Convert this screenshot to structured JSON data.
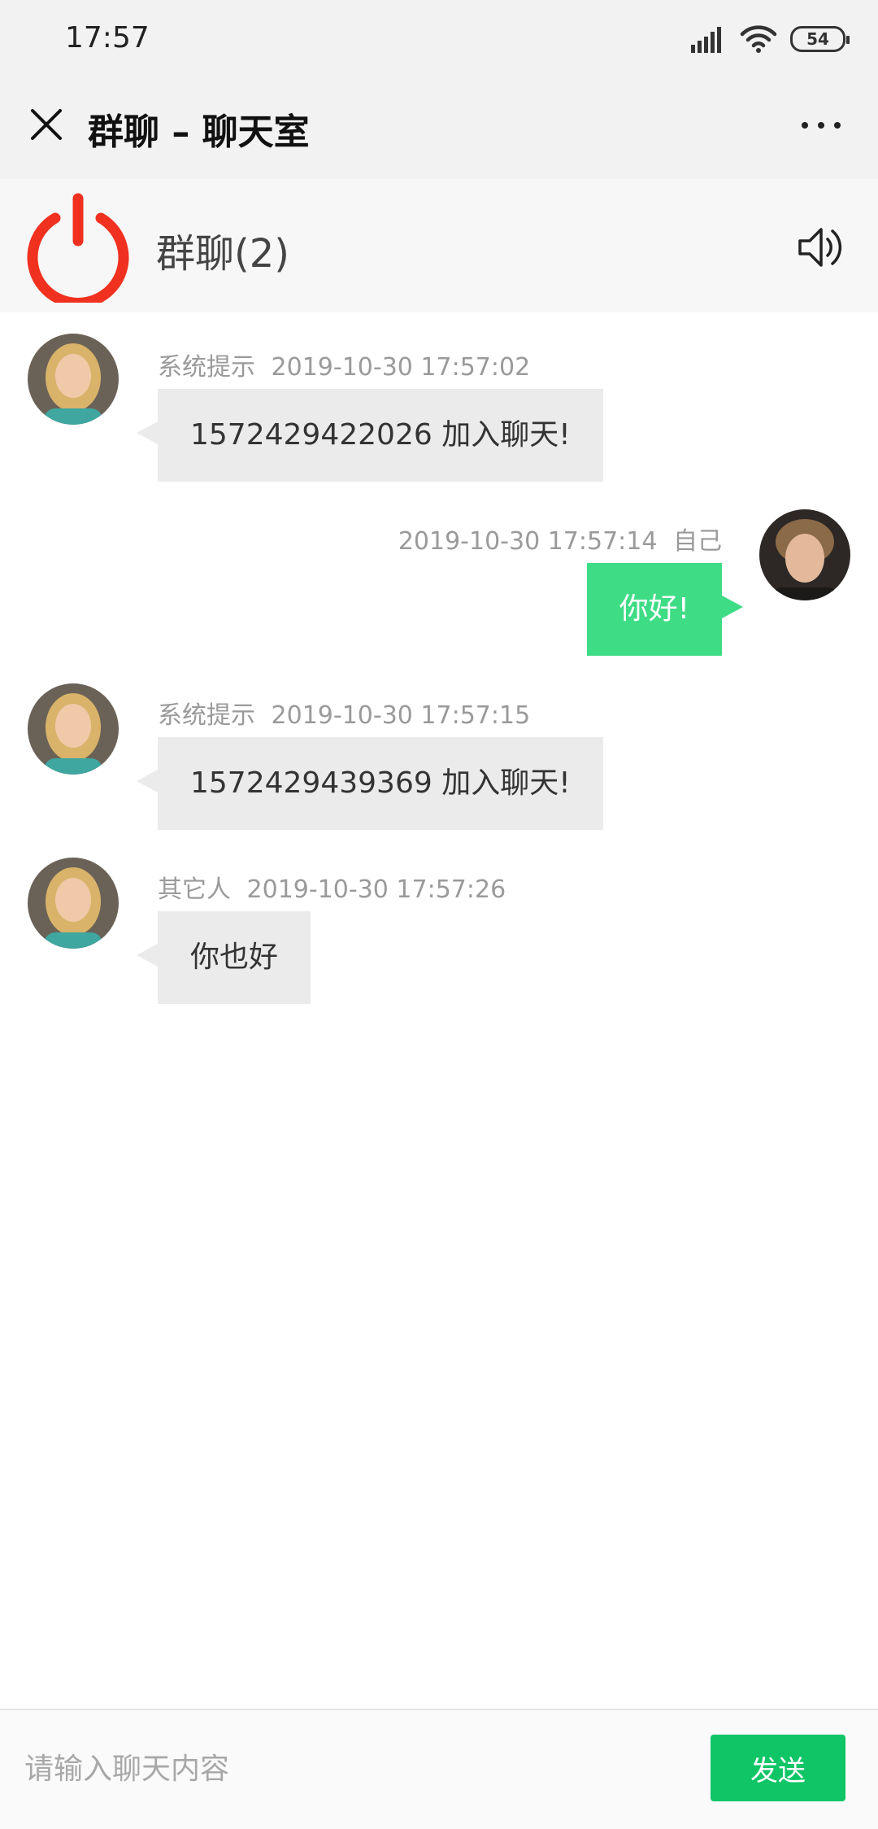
{
  "status_bar": {
    "time": "17:57",
    "battery": "54",
    "icons": [
      "signal-icon",
      "wifi-icon",
      "battery-icon"
    ]
  },
  "header": {
    "title": "群聊 – 聊天室",
    "close_icon": "close-icon",
    "more_icon": "more-icon"
  },
  "room": {
    "name": "群聊(2)",
    "power_icon": "power-icon",
    "sound_icon": "speaker-icon",
    "accent_color": "#f0311f"
  },
  "messages": [
    {
      "side": "left",
      "sender": "系统提示",
      "time": "2019-10-30 17:57:02",
      "text": "1572429422026 加入聊天!"
    },
    {
      "side": "right",
      "sender": "自己",
      "time": "2019-10-30 17:57:14",
      "text": "你好!"
    },
    {
      "side": "left",
      "sender": "系统提示",
      "time": "2019-10-30 17:57:15",
      "text": "1572429439369 加入聊天!"
    },
    {
      "side": "left",
      "sender": "其它人",
      "time": "2019-10-30 17:57:26",
      "text": "你也好"
    }
  ],
  "input": {
    "placeholder": "请输入聊天内容",
    "value": "",
    "send_label": "发送",
    "send_color": "#0fc566",
    "self_bubble_color": "#3fdc86",
    "other_bubble_color": "#ebebeb"
  }
}
